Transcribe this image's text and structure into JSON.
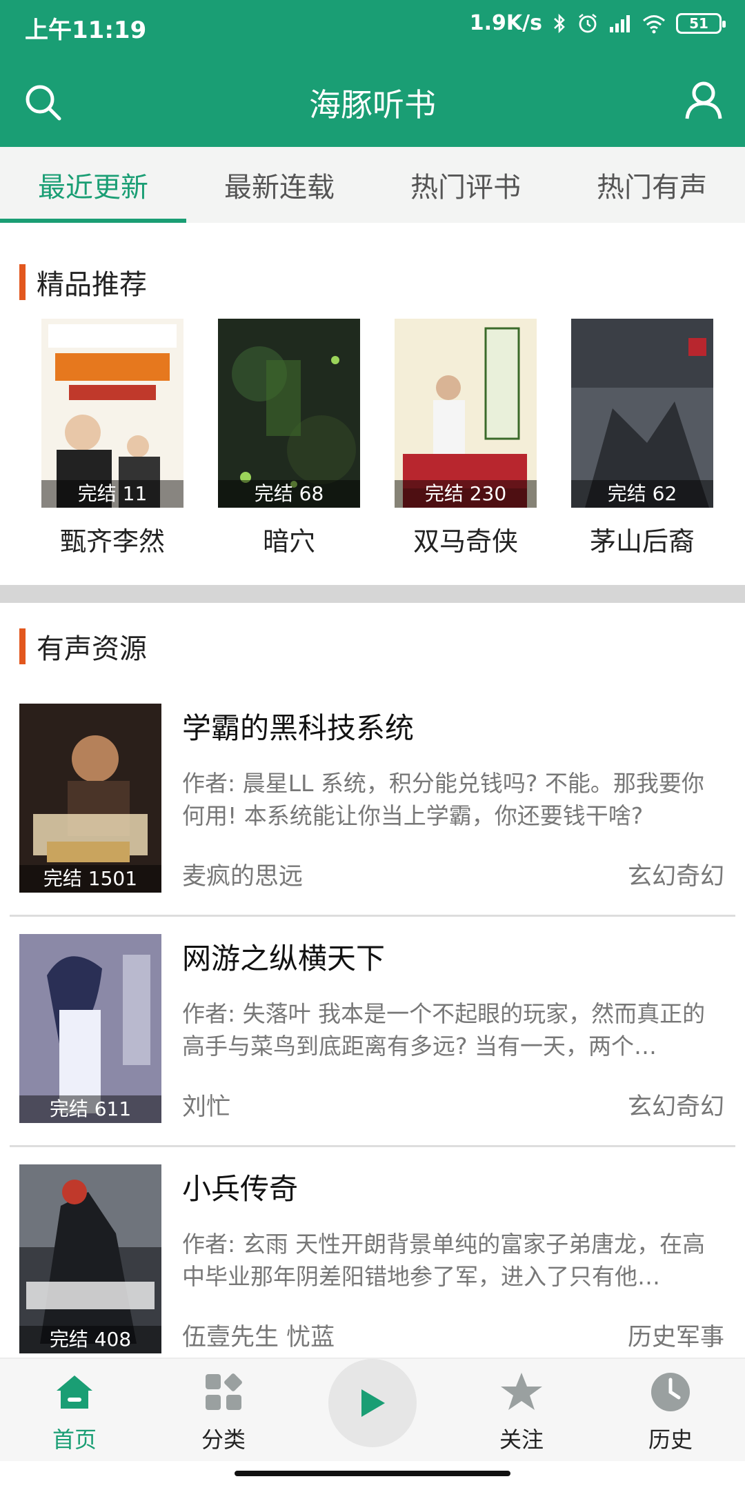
{
  "status_bar": {
    "time": "上午11:19",
    "speed": "1.9K/s",
    "battery": "51"
  },
  "app_bar": {
    "title": "海豚听书"
  },
  "tabs": [
    {
      "label": "最近更新",
      "active": true
    },
    {
      "label": "最新连载",
      "active": false
    },
    {
      "label": "热门评书",
      "active": false
    },
    {
      "label": "热门有声",
      "active": false
    }
  ],
  "featured": {
    "title": "精品推荐",
    "items": [
      {
        "name": "甄齐李然",
        "badge": "完结 11"
      },
      {
        "name": "暗穴",
        "badge": "完结 68"
      },
      {
        "name": "双马奇侠",
        "badge": "完结 230"
      },
      {
        "name": "茅山后裔",
        "badge": "完结 62"
      }
    ]
  },
  "audio_section": {
    "title": "有声资源",
    "items": [
      {
        "title": "学霸的黑科技系统",
        "desc": "作者: 晨星LL 系统，积分能兑钱吗? 不能。那我要你何用! 本系统能让你当上学霸，你还要钱干啥?",
        "author": "麦疯的思远",
        "genre": "玄幻奇幻",
        "badge": "完结 1501"
      },
      {
        "title": "网游之纵横天下",
        "desc": "作者: 失落叶 我本是一个不起眼的玩家，然而真正的高手与菜鸟到底距离有多远? 当有一天，两个…",
        "author": "刘忙",
        "genre": "玄幻奇幻",
        "badge": "完结 611"
      },
      {
        "title": "小兵传奇",
        "desc": "作者: 玄雨 天性开朗背景单纯的富家子弟唐龙，在高中毕业那年阴差阳错地参了军，进入了只有他…",
        "author": "伍壹先生 忧蓝",
        "genre": "历史军事",
        "badge": "完结 408"
      }
    ]
  },
  "bottom_nav": [
    {
      "label": "首页",
      "icon": "home-icon",
      "active": true
    },
    {
      "label": "分类",
      "icon": "category-icon",
      "active": false
    },
    {
      "label": "关注",
      "icon": "star-icon",
      "active": false
    },
    {
      "label": "历史",
      "icon": "clock-icon",
      "active": false
    }
  ],
  "colors": {
    "primary": "#1a9e74",
    "section_accent": "#e2571e"
  }
}
